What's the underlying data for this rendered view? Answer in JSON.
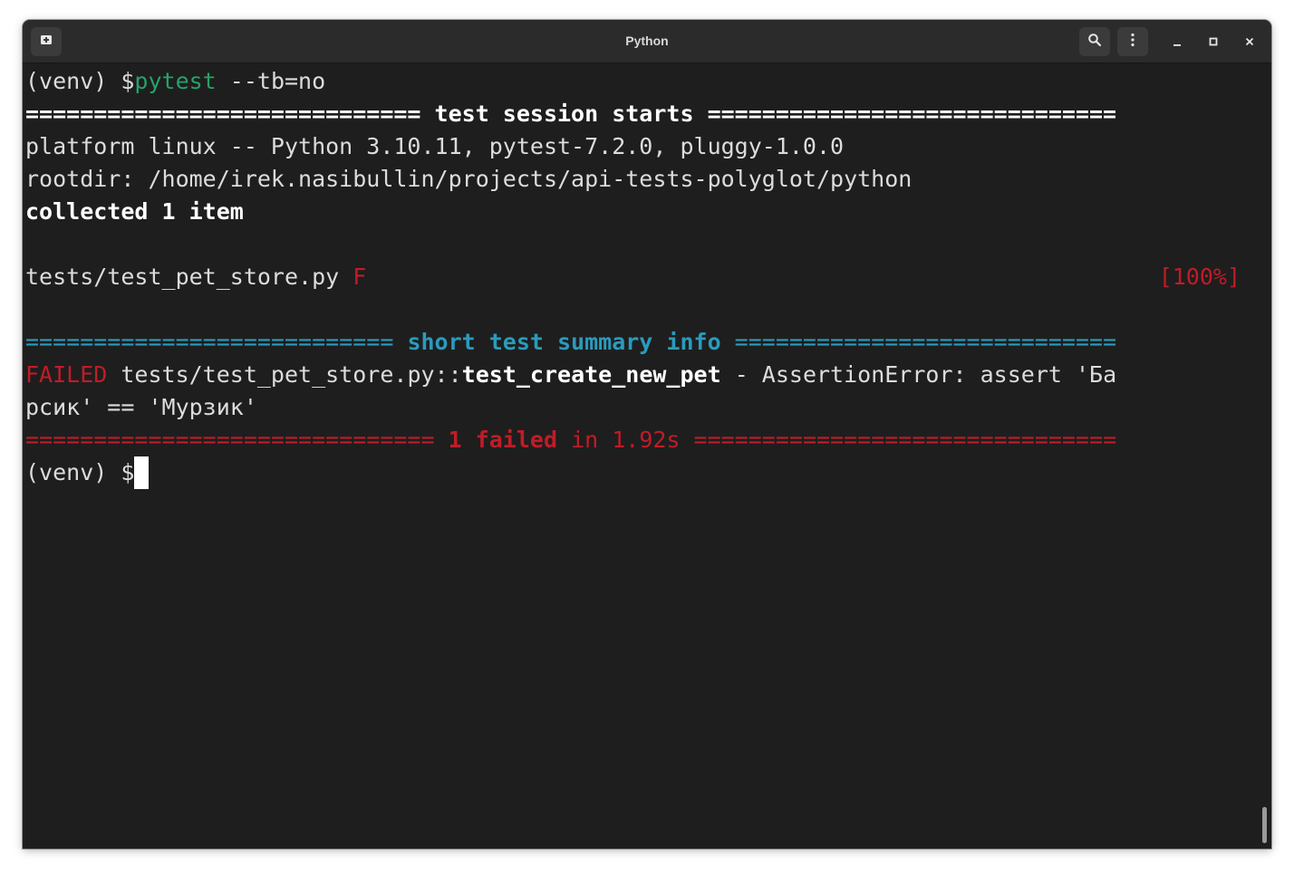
{
  "window": {
    "title": "Python"
  },
  "icons": {
    "new_tab": "new-tab-icon",
    "search": "search-icon",
    "menu": "kebab-menu-icon",
    "minimize": "minimize-icon",
    "maximize": "maximize-icon",
    "close": "close-icon"
  },
  "colors": {
    "green": "#26a269",
    "red": "#c01c28",
    "cyan": "#2a9bbd",
    "background": "#1e1e1e"
  },
  "terminal": {
    "cmd_prompt": "(venv) $",
    "cmd_name": "pytest",
    "cmd_args": " --tb=no",
    "session_line": "============================= test session starts ==============================",
    "platform": "platform linux -- Python 3.10.11, pytest-7.2.0, pluggy-1.0.0",
    "rootdir": "rootdir: /home/irek.nasibullin/projects/api-tests-polyglot/python",
    "collected": "collected 1 item",
    "test_file": "tests/test_pet_store.py",
    "test_result": "F",
    "test_percent": "[100%]",
    "summary_eq_left": "=========================== ",
    "summary_title": "short test summary info",
    "summary_eq_right": " ============================",
    "failed_label": "FAILED",
    "failed_path": " tests/test_pet_store.py::",
    "failed_test": "test_create_new_pet",
    "failed_msg": " - AssertionError: assert 'Ба",
    "failed_cont": "рсик' == 'Мурзик'",
    "result_eq_left": "============================== ",
    "result_failed": "1 failed",
    "result_time": " in 1.92s",
    "result_eq_right": " ===============================",
    "final_prompt": "(venv) $"
  }
}
